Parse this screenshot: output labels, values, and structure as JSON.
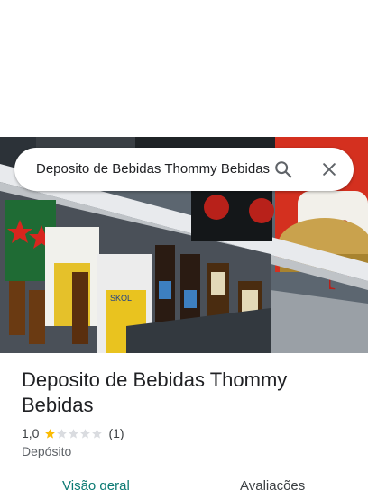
{
  "search": {
    "query": "Deposito de Bebidas Thommy Bebidas",
    "search_icon": "search-icon",
    "close_icon": "close-icon"
  },
  "hero": {
    "image": "store-shelf-with-beer-bottles-photo"
  },
  "place": {
    "name": "Deposito de Bebidas Thommy Bebidas",
    "rating": "1,0",
    "stars_filled": 1,
    "stars_total": 5,
    "review_count": "(1)",
    "category": "Depósito"
  },
  "tabs": [
    {
      "label": "Visão geral",
      "active": true
    },
    {
      "label": "Avaliações",
      "active": false
    }
  ],
  "colors": {
    "accent": "#0b7a73",
    "star_filled": "#fbbc04",
    "star_empty": "#dadce0"
  }
}
